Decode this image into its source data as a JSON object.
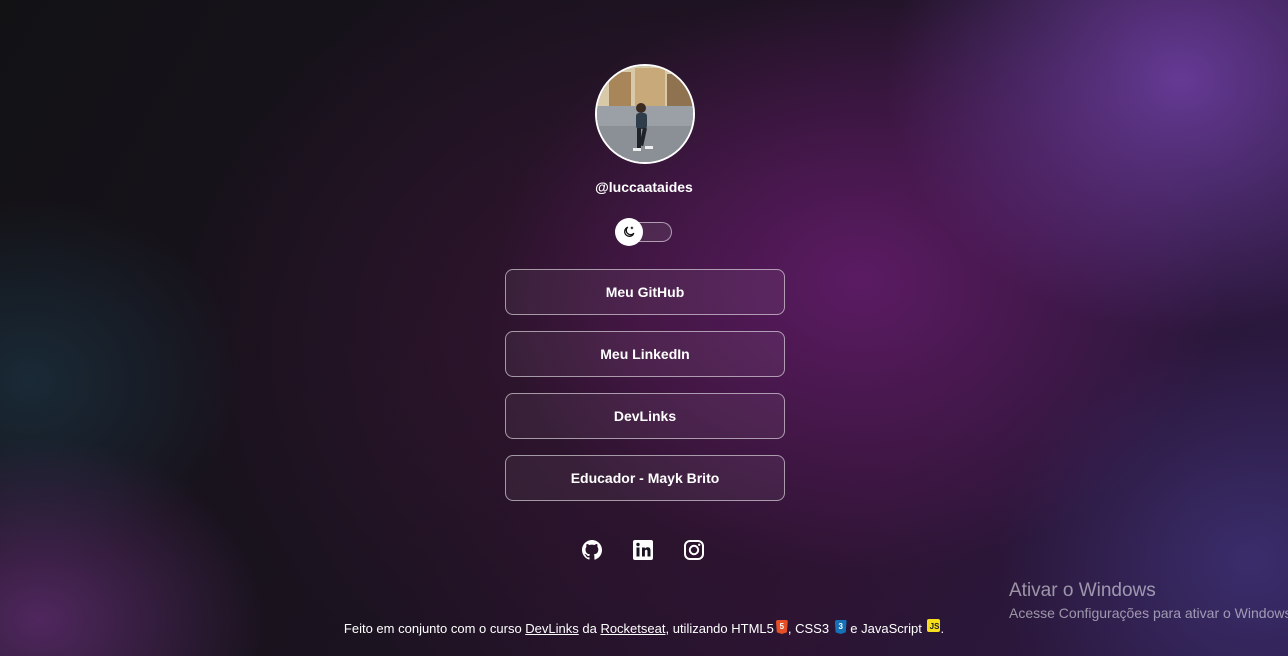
{
  "profile": {
    "avatar_alt": "Foto de perfil",
    "handle": "@luccaataides"
  },
  "theme_switch": {
    "icon": "moon-icon"
  },
  "links": [
    {
      "label": "Meu GitHub"
    },
    {
      "label": "Meu LinkedIn"
    },
    {
      "label": "DevLinks"
    },
    {
      "label": "Educador - Mayk Brito"
    }
  ],
  "social": [
    {
      "icon": "github-icon"
    },
    {
      "icon": "linkedin-icon"
    },
    {
      "icon": "instagram-icon"
    }
  ],
  "footer": {
    "text_1": "Feito em conjunto com o curso ",
    "link_devlinks": "DevLinks",
    "text_2": " da ",
    "link_rocketseat": "Rocketseat",
    "text_3": ", utilizando HTML5",
    "text_4": ", CSS3 ",
    "text_5": " e JavaScript ",
    "text_6": ".",
    "badge_html": "5",
    "badge_css": "3",
    "badge_js": "JS"
  },
  "watermark": {
    "title": "Ativar o Windows",
    "subtitle": "Acesse Configurações para ativar o Windows."
  },
  "colors": {
    "accent_purple": "#6a2a78",
    "text": "#ffffff",
    "html5": "#e34f26",
    "css3": "#1572b6",
    "javascript": "#f7df1e"
  }
}
